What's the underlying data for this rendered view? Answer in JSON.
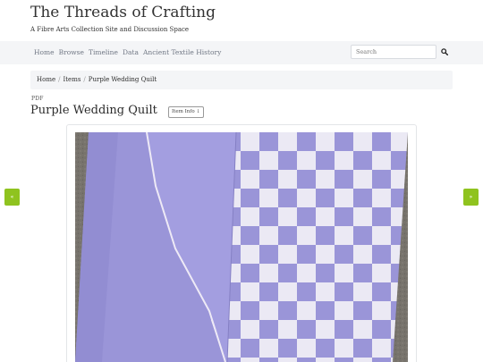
{
  "site": {
    "title": "The Threads of Crafting",
    "tagline": "A Fibre Arts Collection Site and Discussion Space"
  },
  "nav": {
    "items": [
      {
        "label": "Home"
      },
      {
        "label": "Browse"
      },
      {
        "label": "Timeline"
      },
      {
        "label": "Data"
      },
      {
        "label": "Ancient Textile History"
      }
    ],
    "search_placeholder": "Search"
  },
  "breadcrumb": {
    "items": [
      "Home",
      "Items",
      "Purple Wedding Quilt"
    ],
    "separator": "/"
  },
  "item": {
    "format_label": "PDF",
    "title": "Purple Wedding Quilt",
    "info_button": "Item Info ↓"
  },
  "viewer": {
    "prev_symbol": "«",
    "next_symbol": "»",
    "accent": "#8fc31f"
  },
  "colors": {
    "nav_background": "#f4f5f7",
    "nav_text": "#707784",
    "quilt_purple": "#9a95d8",
    "quilt_white": "#ebe9f4",
    "carpet": "#77736c"
  }
}
